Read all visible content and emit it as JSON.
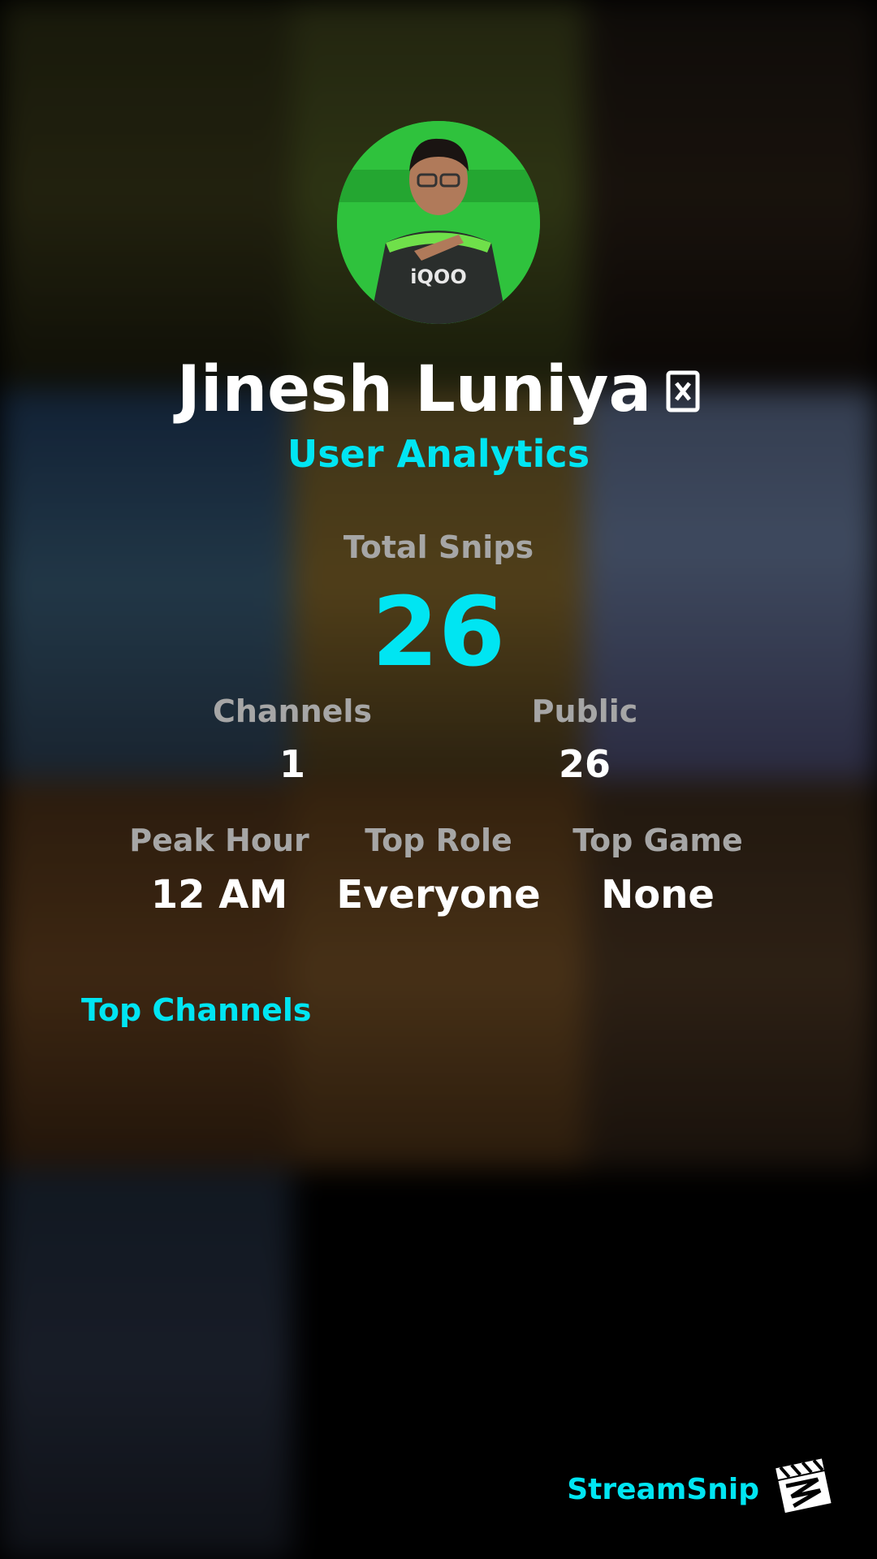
{
  "profile": {
    "name": "Jinesh Luniya",
    "badge_icon": "verified-badge-icon",
    "subtitle": "User Analytics",
    "avatar_shirt_text": "iQOO"
  },
  "stats": {
    "total_snips": {
      "label": "Total Snips",
      "value": "26"
    },
    "channels": {
      "label": "Channels",
      "value": "1"
    },
    "public": {
      "label": "Public",
      "value": "26"
    },
    "peak_hour": {
      "label": "Peak Hour",
      "value": "12 AM"
    },
    "top_role": {
      "label": "Top Role",
      "value": "Everyone"
    },
    "top_game": {
      "label": "Top Game",
      "value": "None"
    }
  },
  "sections": {
    "top_channels_label": "Top Channels"
  },
  "brand": {
    "name": "StreamSnip",
    "logo_icon": "clapperboard-icon"
  },
  "colors": {
    "accent": "#00e5f2",
    "label_gray": "#a6a6a6",
    "text_white": "#ffffff",
    "background": "#000000"
  }
}
